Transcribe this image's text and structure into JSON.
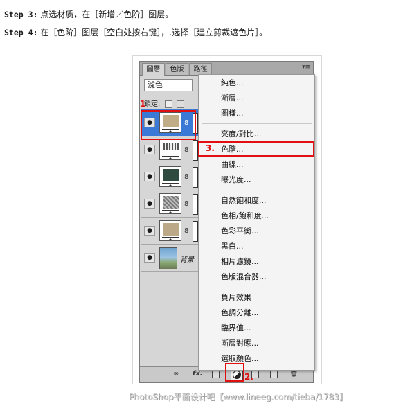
{
  "steps": [
    {
      "label": "Step 3:",
      "text": "点选材质，在［新增／色阶］图层。"
    },
    {
      "label": "Step 4:",
      "text": "在［色阶］图层［空白处按右键］，.选择［建立剪裁遮色片］。"
    }
  ],
  "panel": {
    "tabs": [
      "圖層",
      "色版",
      "路徑"
    ],
    "active_tab": "圖層",
    "menu_glyph": "▾≡",
    "blend_mode": "濾色",
    "lock_label": "鎖定:",
    "layers": [
      {
        "thumb": "adjustment",
        "swatch": "#c0ad87",
        "selected": true
      },
      {
        "thumb": "adjustment",
        "swatch": "#8a8a8a",
        "selected": false
      },
      {
        "thumb": "adjustment",
        "swatch": "#2f4a3e",
        "selected": false
      },
      {
        "thumb": "adjustment",
        "swatch": "#9c9c9c",
        "selected": false
      },
      {
        "thumb": "adjustment",
        "swatch": "#bba886",
        "selected": false
      },
      {
        "thumb": "photo",
        "name": "背景",
        "selected": false
      }
    ],
    "bottom_icons": [
      "link-icon",
      "fx-icon",
      "mask-icon",
      "adjustment-icon",
      "group-icon",
      "new-layer-icon",
      "trash-icon"
    ],
    "fx_label": "fx."
  },
  "menu": {
    "groups": [
      [
        "純色...",
        "漸層...",
        "圖樣..."
      ],
      [
        "亮度/對比...",
        "色階...",
        "曲線...",
        "曝光度..."
      ],
      [
        "自然飽和度...",
        "色相/飽和度...",
        "色彩平衡...",
        "黑白...",
        "相片濾鏡...",
        "色版混合器..."
      ],
      [
        "負片效果",
        "色調分離...",
        "臨界值...",
        "漸層對應...",
        "選取顏色..."
      ]
    ]
  },
  "annotations": {
    "n1": "1",
    "n2": "2.",
    "n3": "3."
  },
  "watermark": "PhotoShop平面设计吧【www.lineeg.com/tieba/1783】",
  "colors": {
    "accent_red": "#e01010",
    "selection_blue": "#3a7ad6"
  }
}
